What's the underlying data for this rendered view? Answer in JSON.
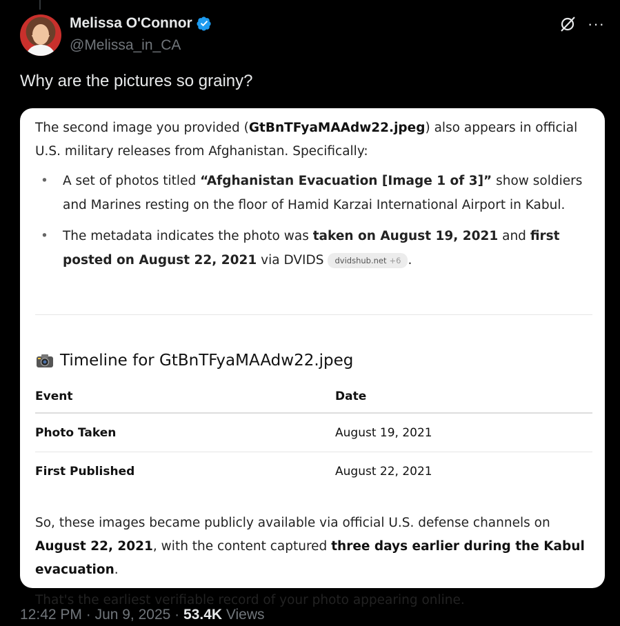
{
  "author": {
    "name": "Melissa O'Connor",
    "handle": "@Melissa_in_CA"
  },
  "tweet_text": "Why are the pictures so grainy?",
  "card": {
    "intro_a": "The second image you provided (",
    "intro_file": "GtBnTFyaMAAdw22.jpeg",
    "intro_b": ") also appears in official U.S. military releases from Afghanistan. Specifically:",
    "bullet1_a": "A set of photos titled ",
    "bullet1_title": "“Afghanistan Evacuation [Image 1 of 3]”",
    "bullet1_b": " show soldiers and Marines resting on the floor of Hamid Karzai International Airport in Kabul.",
    "bullet2_a": "The metadata indicates the photo was ",
    "bullet2_taken": "taken on August 19, 2021",
    "bullet2_and": " and ",
    "bullet2_posted": "first posted on August 22, 2021",
    "bullet2_via": " via DVIDS",
    "chip_label": "dvidshub.net",
    "chip_more": "+6",
    "bullet2_end": ".",
    "heading": "Timeline for GtBnTFyaMAAdw22.jpeg",
    "table": {
      "headers": [
        "Event",
        "Date"
      ],
      "rows": [
        [
          "Photo Taken",
          "August 19, 2021"
        ],
        [
          "First Published",
          "August 22, 2021"
        ]
      ]
    },
    "closing1_a": "So, these images became publicly available via official U.S. defense channels on ",
    "closing1_date": "August 22, 2021",
    "closing1_b": ", with the content captured ",
    "closing1_bold": "three days earlier during the Kabul evacuation",
    "closing1_end": ".",
    "closing2": "That's the earliest verifiable record of your photo appearing online."
  },
  "meta": {
    "time": "12:42 PM",
    "sep1": " · ",
    "date": "Jun 9, 2025",
    "sep2": " · ",
    "views_count": "53.4K",
    "views_label": " Views"
  },
  "icons": {
    "verified": "verified-badge-icon",
    "grok": "grok-icon",
    "more": "more-icon",
    "camera": "camera-icon"
  },
  "colors": {
    "background": "#000000",
    "verified": "#1d9bf0",
    "secondary_text": "#71767b"
  }
}
